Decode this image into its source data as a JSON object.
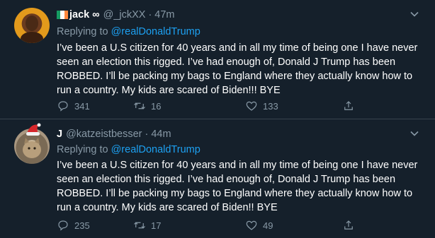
{
  "tweets": [
    {
      "display_name": "jack ∞",
      "handle": "@_jckXX",
      "separator": "·",
      "time": "47m",
      "replying_prefix": "Replying to",
      "replying_to": "@realDonaldTrump",
      "text": "I’ve been a U.S citizen for 40 years and in all my time of being one I have never seen an election this rigged. I’ve had enough of, Donald J Trump has been ROBBED. I’ll be packing my bags to England where they actually know how to run a country. My kids are scared of Biden!!! BYE",
      "replies": "341",
      "retweets": "16",
      "likes": "133"
    },
    {
      "display_name": "J",
      "handle": "@katzeistbesser",
      "separator": "·",
      "time": "44m",
      "replying_prefix": "Replying to",
      "replying_to": "@realDonaldTrump",
      "text": "I’ve been a U.S citizen for 40 years and in all my time of being one I have never seen an election this rigged. I’ve had enough of, Donald J Trump has been ROBBED. I’ll be packing my bags to England where they actually know how to run a country. My kids are scared of Biden!! BYE",
      "replies": "235",
      "retweets": "17",
      "likes": "49"
    }
  ],
  "colors": {
    "background": "#15202b",
    "secondary_text": "#8899a6",
    "link": "#1da1f2",
    "divider": "#38444d"
  },
  "icons": [
    "irish-flag-icon",
    "caret-down-icon",
    "reply-icon",
    "retweet-icon",
    "like-icon",
    "share-icon",
    "santa-hat-icon"
  ]
}
